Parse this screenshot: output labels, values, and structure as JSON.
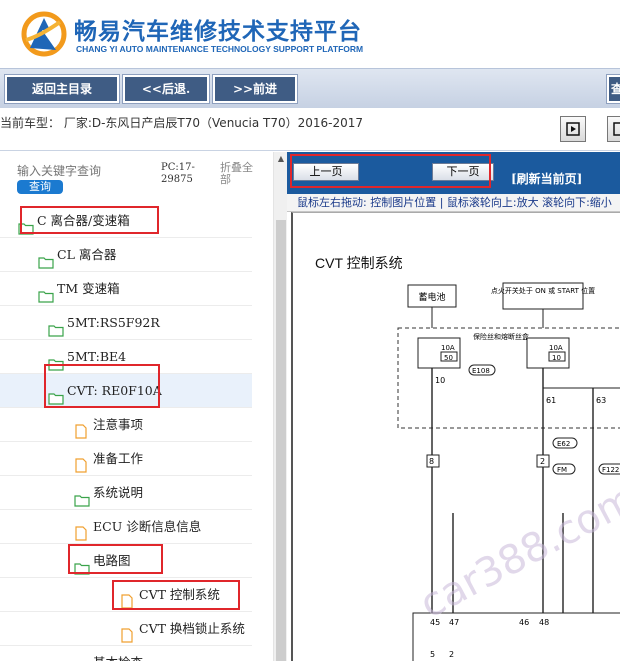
{
  "header": {
    "title_zh": "畅易汽车维修技术支持平台",
    "title_en": "CHANG YI AUTO MAINTENANCE TECHNOLOGY SUPPORT PLATFORM"
  },
  "nav": {
    "home": "返回主目录",
    "back": "<<后退.",
    "forward": ">>前进",
    "edge": "查"
  },
  "vehicle": {
    "text": "当前车型： 厂家:D-东风日产启辰T70（Venucia T70）2016-2017"
  },
  "sidebar": {
    "search_placeholder": "输入关键字查询",
    "search_button": "查询",
    "pc_code": "PC:17-29875",
    "collapse_all": "折叠全部",
    "items": [
      {
        "label": "C 离合器/变速箱",
        "type": "folder"
      },
      {
        "label": "CL 离合器",
        "type": "folder"
      },
      {
        "label": "TM 变速箱",
        "type": "folder"
      },
      {
        "label": "5MT:RS5F92R",
        "type": "folder"
      },
      {
        "label": "5MT:BE4",
        "type": "folder"
      },
      {
        "label": "CVT: RE0F10A",
        "type": "folder"
      },
      {
        "label": "注意事项",
        "type": "doc"
      },
      {
        "label": "准备工作",
        "type": "doc"
      },
      {
        "label": "系统说明",
        "type": "folder"
      },
      {
        "label": "ECU 诊断信息信息",
        "type": "doc"
      },
      {
        "label": "电路图",
        "type": "folder"
      },
      {
        "label": "CVT 控制系统",
        "type": "doc"
      },
      {
        "label": "CVT 换档锁止系统",
        "type": "doc"
      },
      {
        "label": "基本检查",
        "type": "folder"
      }
    ]
  },
  "viewer": {
    "prev": "上一页",
    "next": "下一页",
    "refresh": "[刷新当前页]",
    "hint": "鼠标左右拖动: 控制图片位置 | 鼠标滚轮向上:放大  滚轮向下:缩小",
    "diagram": {
      "title": "CVT 控制系统",
      "labels": {
        "battery": "蓄电池",
        "ignition": "点火开关处于 ON 或 START 位置",
        "fuse_note": "保险丝和熔断丝盒",
        "fuse1": "10A",
        "fuse1_num": "50",
        "fuse2": "10A",
        "fuse2_num": "10",
        "e108": "E108",
        "e62": "E62",
        "f_m": "FM",
        "f122": "F122",
        "pin_10": "10",
        "pin_61": "61",
        "pin_63": "63",
        "pin_8": "8",
        "pin_2": "2",
        "pin_45": "45",
        "pin_47": "47",
        "pin_46": "46",
        "pin_48": "48",
        "pin_5": "5",
        "pin_2b": "2"
      }
    },
    "watermark": "car388.com"
  }
}
